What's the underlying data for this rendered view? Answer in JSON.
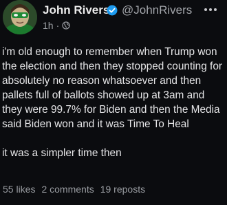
{
  "post": {
    "author_name": "John Rivers",
    "handle": "@JohnRivers",
    "time": "1h",
    "separator": "·",
    "paragraphs": [
      "i'm old enough to remember when Trump won the election and then they stopped counting for absolutely no reason whatsoever and then pallets full of ballots showed up at 3am and they were 99.7% for Biden and then the Media said Biden won and it was Time To Heal",
      "it was a simpler time then"
    ],
    "stats": {
      "likes": "55 likes",
      "comments": "2 comments",
      "reposts": "19 reposts"
    },
    "icons": {
      "verified": "verified-badge-icon",
      "visibility": "globe-icon",
      "more": "more-options-icon",
      "avatar": "avatar"
    },
    "colors": {
      "background": "#0b0c0f",
      "verified": "#1d9bf0"
    }
  }
}
